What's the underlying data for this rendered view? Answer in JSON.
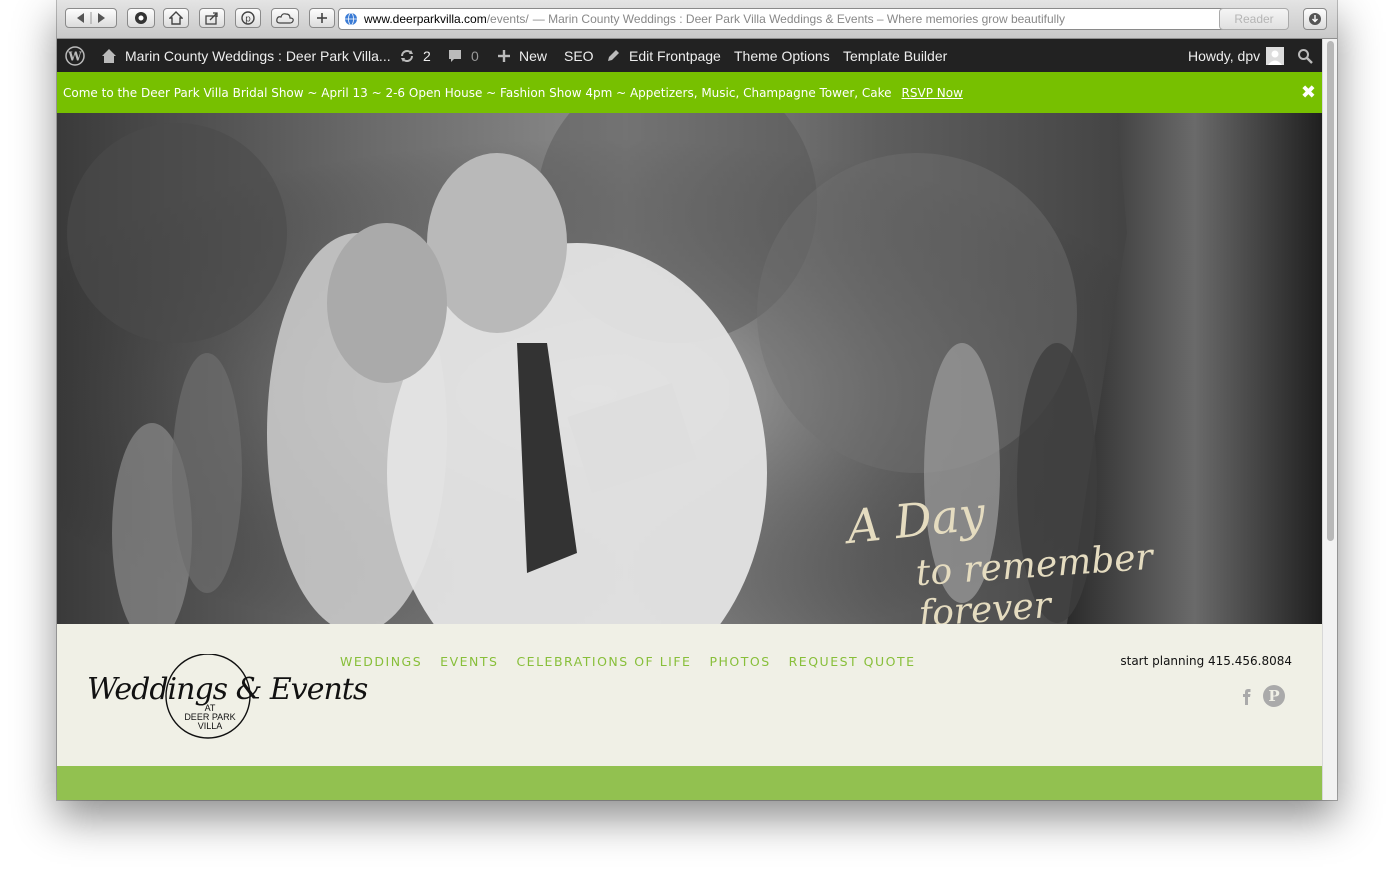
{
  "browser": {
    "url_domain": "www.deerparkvilla.com",
    "url_path": "/events/",
    "page_title": "— Marin County Weddings : Deer Park Villa Weddings & Events – Where memories grow beautifully",
    "reader_label": "Reader",
    "icons": [
      "back-icon",
      "forward-icon",
      "shield-icon",
      "home-icon",
      "share-icon",
      "pinterest-icon",
      "cloud-icon",
      "plus-icon",
      "globe-icon",
      "reload-icon",
      "download-icon"
    ]
  },
  "adminbar": {
    "site_name": "Marin County Weddings : Deer Park Villa...",
    "updates_count": "2",
    "comments_count": "0",
    "new_label": "New",
    "seo_label": "SEO",
    "edit_frontpage_label": "Edit Frontpage",
    "theme_options_label": "Theme Options",
    "template_builder_label": "Template Builder",
    "howdy_label": "Howdy, dpv"
  },
  "notice": {
    "text": "Come to the Deer Park Villa Bridal Show ~ April 13 ~ 2-6 Open House ~ Fashion Show 4pm ~ Appetizers, Music, Champagne Tower, Cake",
    "link_label": "RSVP Now",
    "close_glyph": "✖",
    "color": "#77c000"
  },
  "hero": {
    "script_line1": "A Day",
    "script_line2": "to remember forever"
  },
  "header": {
    "logo_script": "Weddings & Events",
    "logo_small": [
      "AT",
      "DEER PARK",
      "VILLA"
    ],
    "nav": [
      "WEDDINGS",
      "EVENTS",
      "CELEBRATIONS OF LIFE",
      "PHOTOS",
      "REQUEST QUOTE"
    ],
    "phone": "start planning 415.456.8084",
    "nav_color": "#88bf3a",
    "band_color": "#92c150"
  }
}
